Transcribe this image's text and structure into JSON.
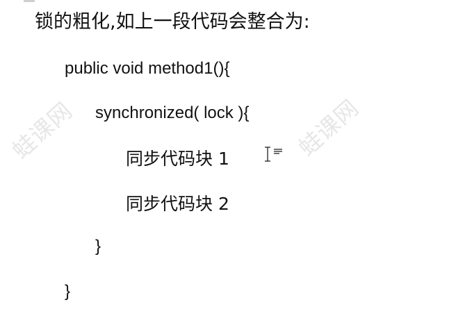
{
  "document": {
    "heading": "锁的粗化,如上一段代码会整合为:",
    "code_lines": [
      "public void    method1(){",
      "synchronized( lock ){",
      "同步代码块 1",
      "同步代码块 2",
      "}",
      "}"
    ]
  },
  "watermark": {
    "text": "蛙课网"
  },
  "icons": {
    "cursor": "text-cursor-icon"
  }
}
